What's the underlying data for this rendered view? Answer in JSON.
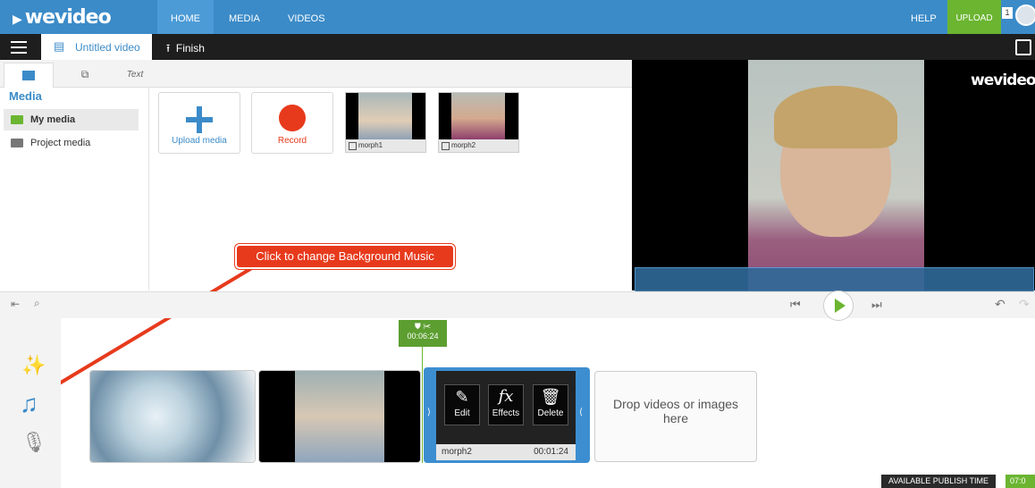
{
  "nav": {
    "logo": "wevideo",
    "links": [
      "HOME",
      "MEDIA",
      "VIDEOS"
    ],
    "help": "HELP",
    "upload": "UPLOAD",
    "notifications": "1"
  },
  "project": {
    "title": "Untitled video",
    "finish": "Finish"
  },
  "media_tabs": [
    "media",
    "transitions",
    "Text"
  ],
  "media_panel": {
    "heading": "Media",
    "items": [
      {
        "label": "My media",
        "active": true
      },
      {
        "label": "Project media",
        "active": false
      }
    ],
    "tiles": [
      {
        "label": "Upload media",
        "icon": "plus-icon",
        "color": "#3b8bc8"
      },
      {
        "label": "Record",
        "icon": "record-icon",
        "color": "#e73a1c"
      }
    ],
    "thumbs": [
      {
        "label": "morph1"
      },
      {
        "label": "morph2"
      }
    ]
  },
  "callout": "Click to change Background Music",
  "preview": {
    "watermark": "wevideo"
  },
  "timeline": {
    "cursor_time": "00:06:24",
    "selected_clip": {
      "name": "morph2",
      "duration": "00:01:24",
      "actions": [
        {
          "icon": "pencil-icon",
          "label": "Edit"
        },
        {
          "icon": "fx-icon",
          "label": "Effects"
        },
        {
          "icon": "trash-icon",
          "label": "Delete"
        }
      ]
    },
    "dropzone": "Drop videos or images here"
  },
  "publish": {
    "label": "AVAILABLE PUBLISH TIME",
    "value": "07:0"
  },
  "colors": {
    "nav_blue": "#3b8bc8",
    "accent_green": "#6bb531",
    "callout_red": "#e73a1c"
  }
}
